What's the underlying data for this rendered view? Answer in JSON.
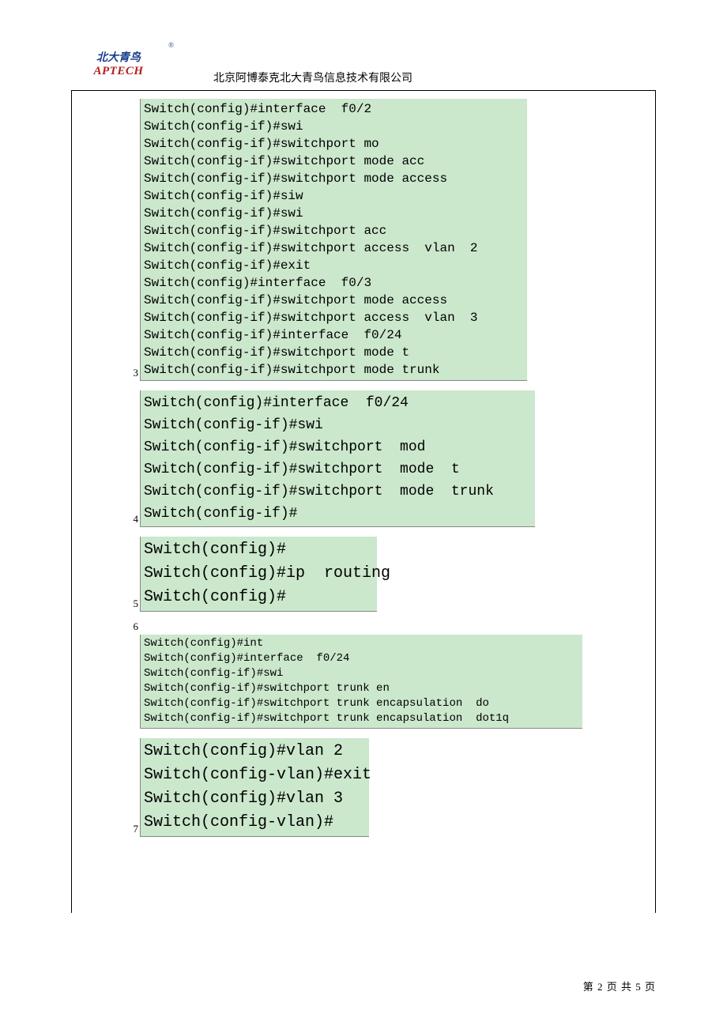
{
  "header": {
    "logo_top": "北大青鸟",
    "logo_bottom": "APTECH",
    "company": "北京阿博泰克北大青鸟信息技术有限公司"
  },
  "blocks": {
    "b3": {
      "num": "3",
      "code": "Switch(config)#interface  f0/2\nSwitch(config-if)#swi\nSwitch(config-if)#switchport mo\nSwitch(config-if)#switchport mode acc\nSwitch(config-if)#switchport mode access\nSwitch(config-if)#siw\nSwitch(config-if)#swi\nSwitch(config-if)#switchport acc\nSwitch(config-if)#switchport access  vlan  2\nSwitch(config-if)#exit\nSwitch(config)#interface  f0/3\nSwitch(config-if)#switchport mode access\nSwitch(config-if)#switchport access  vlan  3\nSwitch(config-if)#interface  f0/24\nSwitch(config-if)#switchport mode t\nSwitch(config-if)#switchport mode trunk"
    },
    "b4": {
      "num": "4",
      "code": "Switch(config)#interface  f0/24\nSwitch(config-if)#swi\nSwitch(config-if)#switchport  mod\nSwitch(config-if)#switchport  mode  t\nSwitch(config-if)#switchport  mode  trunk\nSwitch(config-if)#"
    },
    "b5": {
      "num": "5",
      "code": "Switch(config)#\nSwitch(config)#ip  routing\nSwitch(config)#"
    },
    "b6_num": "6",
    "b6": {
      "code": "Switch(config)#int\nSwitch(config)#interface  f0/24\nSwitch(config-if)#swi\nSwitch(config-if)#switchport trunk en\nSwitch(config-if)#switchport trunk encapsulation  do\nSwitch(config-if)#switchport trunk encapsulation  dot1q"
    },
    "b7": {
      "num": "7",
      "code": "Switch(config)#vlan 2\nSwitch(config-vlan)#exit\nSwitch(config)#vlan 3\nSwitch(config-vlan)#"
    }
  },
  "footer": {
    "text": "第 2 页 共 5 页"
  }
}
